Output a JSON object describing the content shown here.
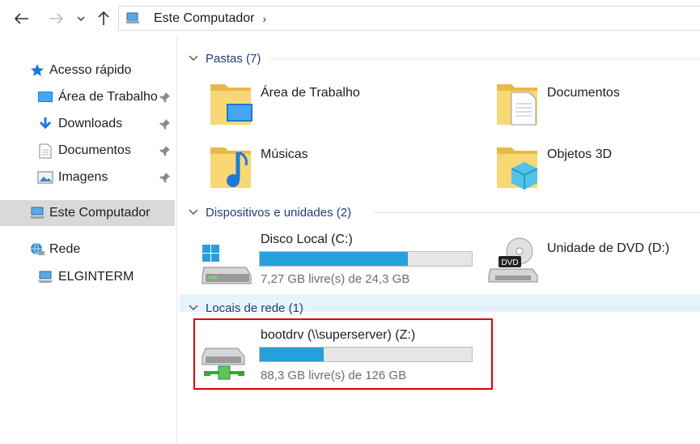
{
  "toolbar": {
    "back_icon": "arrow-left-icon",
    "forward_icon": "arrow-right-icon",
    "recent_icon": "chevron-down-icon",
    "up_icon": "arrow-up-icon"
  },
  "address": {
    "icon": "computer-icon",
    "crumb": "Este Computador",
    "chevron": "›"
  },
  "sidebar": {
    "quick_access": "Acesso rápido",
    "items": [
      {
        "label": "Área de Trabalho",
        "icon": "desktop-icon",
        "pinned": true
      },
      {
        "label": "Downloads",
        "icon": "download-icon",
        "pinned": true
      },
      {
        "label": "Documentos",
        "icon": "document-icon",
        "pinned": true
      },
      {
        "label": "Imagens",
        "icon": "pictures-icon",
        "pinned": true
      }
    ],
    "this_pc": "Este Computador",
    "network": "Rede",
    "network_host": "ELGINTERM"
  },
  "groups": {
    "folders": {
      "title": "Pastas (7)",
      "items": [
        {
          "label": "Área de Trabalho"
        },
        {
          "label": "Documentos"
        },
        {
          "label": "Músicas"
        },
        {
          "label": "Objetos 3D"
        }
      ]
    },
    "devices": {
      "title": "Dispositivos e unidades (2)",
      "local_disk": {
        "label": "Disco Local (C:)",
        "free": "7,27 GB livre(s) de 24,3 GB",
        "used_fraction": 0.7
      },
      "dvd": {
        "label": "Unidade de DVD (D:)"
      }
    },
    "network": {
      "title": "Locais de rede (1)",
      "drive": {
        "label": "bootdrv (\\\\superserver) (Z:)",
        "free": "88,3 GB livre(s) de 126 GB",
        "used_fraction": 0.3
      }
    }
  },
  "colors": {
    "accent_bar": "#26a0da",
    "group_title": "#1e3f7a",
    "highlight": "#e00000"
  }
}
